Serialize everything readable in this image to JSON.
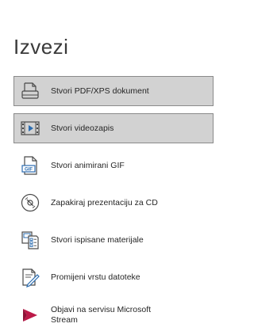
{
  "panel": {
    "title": "Izvezi",
    "items": [
      {
        "label": "Stvori PDF/XPS dokument",
        "icon": "pdf-document-icon",
        "selected": true
      },
      {
        "label": "Stvori videozapis",
        "icon": "video-film-icon",
        "selected": true
      },
      {
        "label": "Stvori animirani GIF",
        "icon": "gif-file-icon",
        "icon_text": "GIF",
        "selected": false
      },
      {
        "label": "Zapakiraj prezentaciju za CD",
        "icon": "cd-disc-icon",
        "selected": false
      },
      {
        "label": "Stvori ispisane materijale",
        "icon": "handouts-icon",
        "selected": false
      },
      {
        "label": "Promijeni vrstu datoteke",
        "icon": "change-file-type-icon",
        "selected": false
      },
      {
        "label_line1": "Objavi na servisu Microsoft",
        "label_line2": "Stream",
        "icon": "microsoft-stream-icon",
        "selected": false
      }
    ]
  },
  "colors": {
    "selected_bg": "#d2d2d2",
    "selected_border": "#8a8a8a",
    "icon_stroke": "#4a4a4a",
    "icon_accent_blue": "#2b6cb0",
    "stream_red": "#bc1948"
  }
}
